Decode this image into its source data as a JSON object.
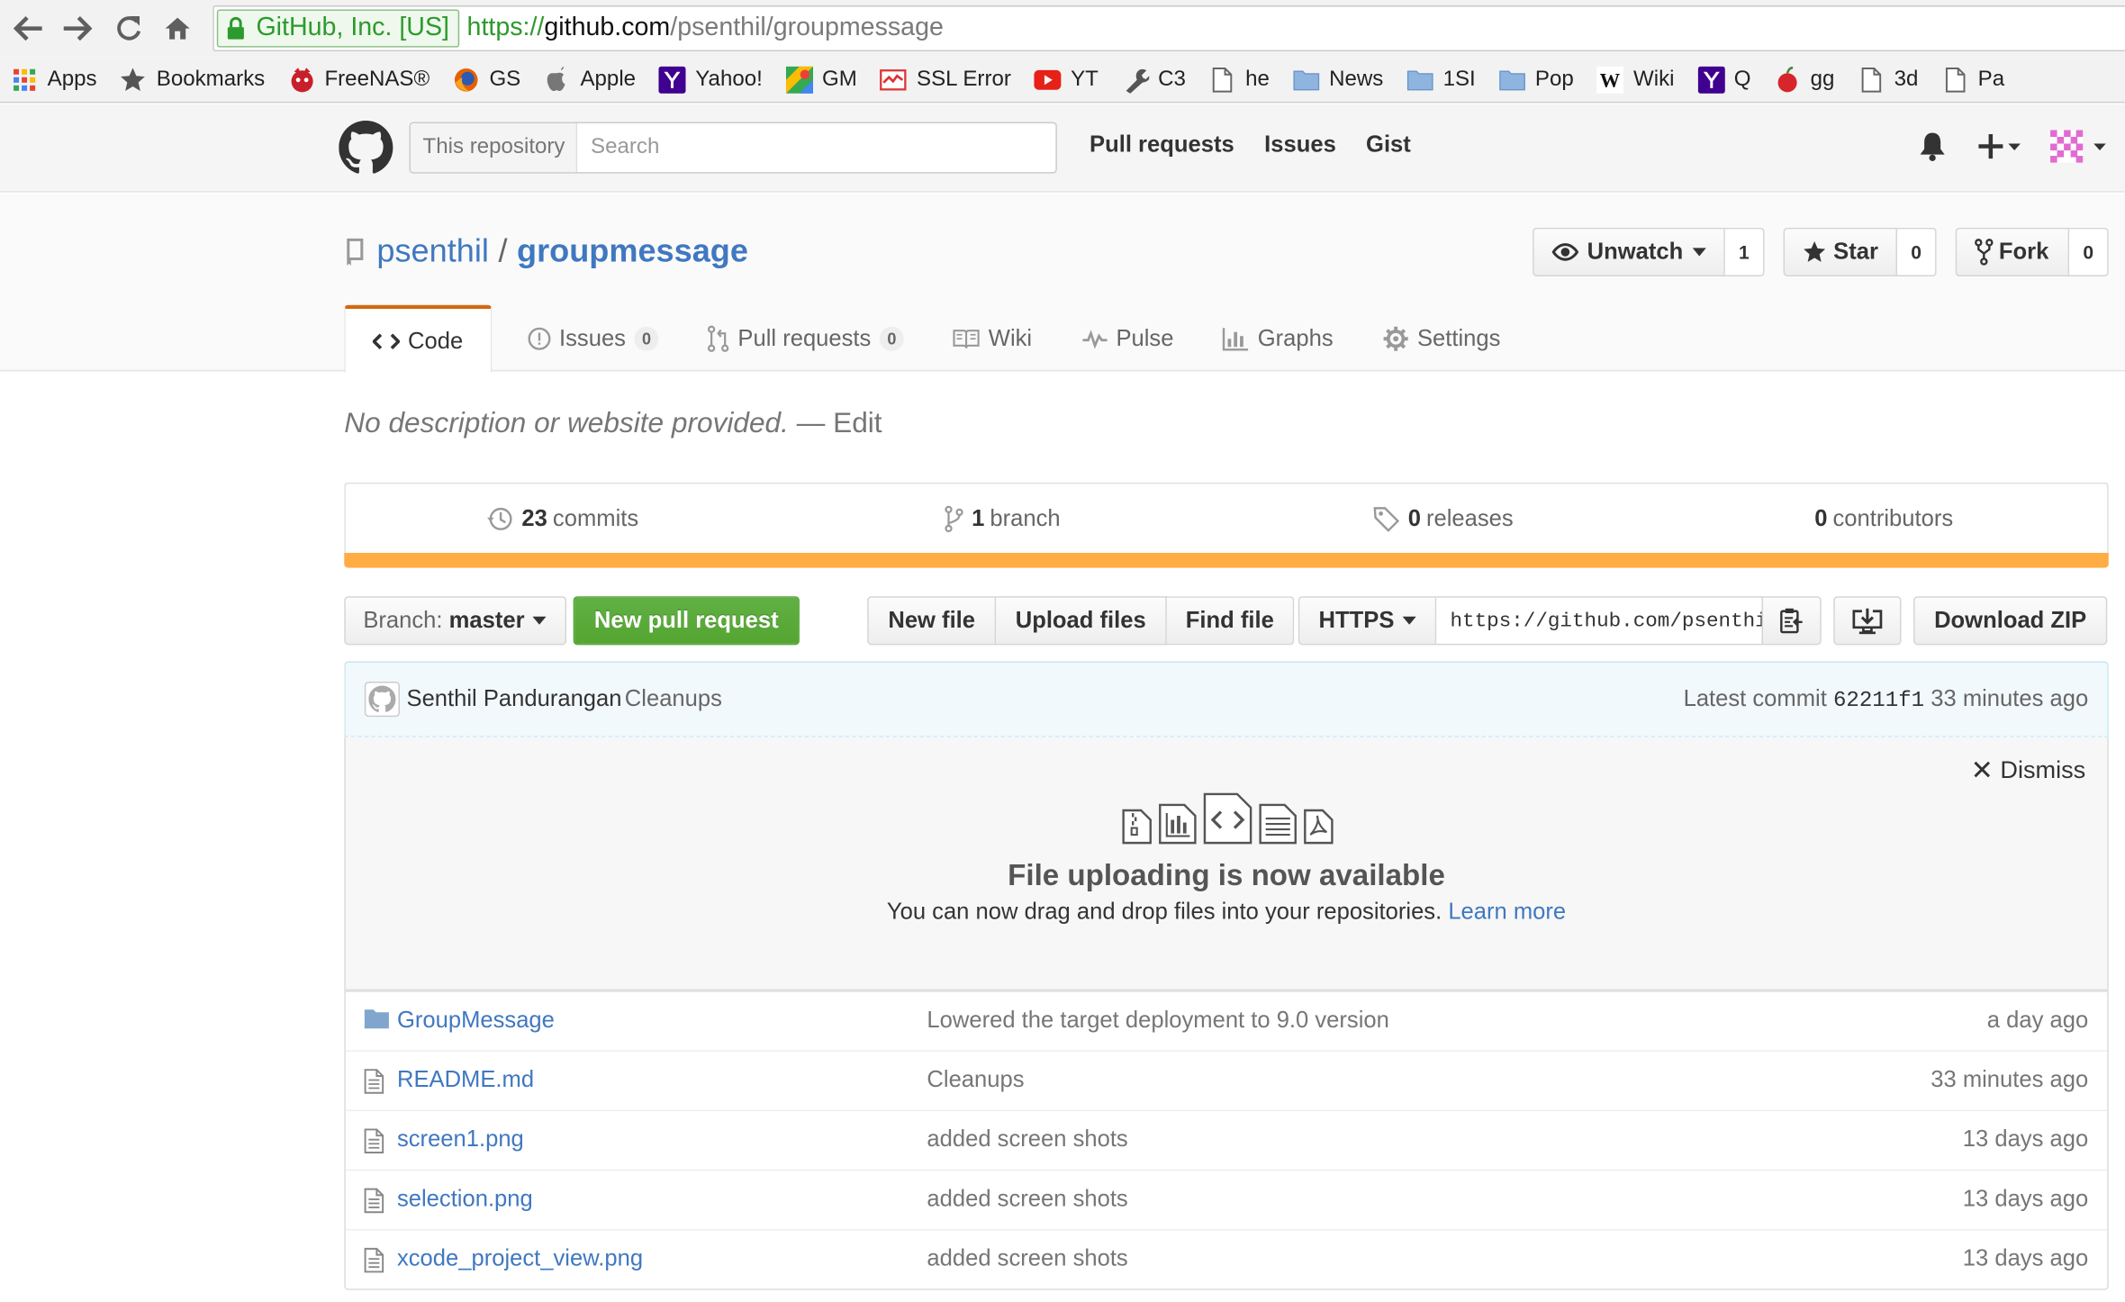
{
  "browser": {
    "ev_label": "GitHub, Inc. [US]",
    "url_scheme": "https://",
    "url_host": "github.com",
    "url_path": "/psenthil/groupmessage",
    "bookmarks": [
      {
        "label": "Apps",
        "icon": "apps-grid-icon"
      },
      {
        "label": "Bookmarks",
        "icon": "star-icon"
      },
      {
        "label": "FreeNAS®",
        "icon": "freenas-icon"
      },
      {
        "label": "GS",
        "icon": "firefox-icon"
      },
      {
        "label": "Apple",
        "icon": "apple-icon"
      },
      {
        "label": "Yahoo!",
        "icon": "yahoo-icon"
      },
      {
        "label": "GM",
        "icon": "google-maps-icon"
      },
      {
        "label": "SSL Error",
        "icon": "ssl-error-icon"
      },
      {
        "label": "YT",
        "icon": "youtube-icon"
      },
      {
        "label": "C3",
        "icon": "wrench-icon"
      },
      {
        "label": "he",
        "icon": "page-icon"
      },
      {
        "label": "News",
        "icon": "folder-icon"
      },
      {
        "label": "1SI",
        "icon": "folder-icon"
      },
      {
        "label": "Pop",
        "icon": "folder-icon"
      },
      {
        "label": "Wiki",
        "icon": "wikipedia-icon"
      },
      {
        "label": "Q",
        "icon": "yahoo-icon"
      },
      {
        "label": "gg",
        "icon": "apple-fruit-icon"
      },
      {
        "label": "3d",
        "icon": "page-icon"
      },
      {
        "label": "Pa",
        "icon": "page-icon"
      }
    ]
  },
  "header": {
    "search_scope": "This repository",
    "search_placeholder": "Search",
    "nav": [
      "Pull requests",
      "Issues",
      "Gist"
    ]
  },
  "repo": {
    "owner": "psenthil",
    "separator": "/",
    "name": "groupmessage",
    "watch": {
      "label": "Unwatch",
      "count": "1"
    },
    "star": {
      "label": "Star",
      "count": "0"
    },
    "fork": {
      "label": "Fork",
      "count": "0"
    },
    "tabs": [
      {
        "label": "Code",
        "icon": "code-icon"
      },
      {
        "label": "Issues",
        "count": "0",
        "icon": "issue-icon"
      },
      {
        "label": "Pull requests",
        "count": "0",
        "icon": "pull-request-icon"
      },
      {
        "label": "Wiki",
        "icon": "book-icon"
      },
      {
        "label": "Pulse",
        "icon": "pulse-icon"
      },
      {
        "label": "Graphs",
        "icon": "graph-icon"
      },
      {
        "label": "Settings",
        "icon": "gear-icon"
      }
    ],
    "description": "No description or website provided.",
    "dash": "—",
    "edit_label": "Edit"
  },
  "summary": {
    "commits": {
      "count": "23",
      "label": "commits"
    },
    "branches": {
      "count": "1",
      "label": "branch"
    },
    "releases": {
      "count": "0",
      "label": "releases"
    },
    "contributors": {
      "count": "0",
      "label": "contributors"
    },
    "language_color": "#ffac45"
  },
  "file_nav": {
    "branch_prefix": "Branch:",
    "branch_name": "master",
    "new_pr": "New pull request",
    "new_file": "New file",
    "upload_files": "Upload files",
    "find_file": "Find file",
    "protocol": "HTTPS",
    "clone_url": "https://github.com/psenthil/groupmessage.git",
    "download_zip": "Download ZIP"
  },
  "commit": {
    "author": "Senthil Pandurangan",
    "message": "Cleanups",
    "latest_label": "Latest commit",
    "sha": "62211f1",
    "age": "33 minutes ago"
  },
  "upload_banner": {
    "dismiss": "Dismiss",
    "title": "File uploading is now available",
    "text": "You can now drag and drop files into your repositories.",
    "link": "Learn more"
  },
  "files": [
    {
      "type": "folder",
      "name": "GroupMessage",
      "message": "Lowered the target deployment to 9.0 version",
      "age": "a day ago"
    },
    {
      "type": "file",
      "name": "README.md",
      "message": "Cleanups",
      "age": "33 minutes ago"
    },
    {
      "type": "file",
      "name": "screen1.png",
      "message": "added screen shots",
      "age": "13 days ago"
    },
    {
      "type": "file",
      "name": "selection.png",
      "message": "added screen shots",
      "age": "13 days ago"
    },
    {
      "type": "file",
      "name": "xcode_project_view.png",
      "message": "added screen shots",
      "age": "13 days ago"
    }
  ],
  "colors": {
    "link": "#4078c0",
    "green_button": "#55a532",
    "tab_accent": "#d26911"
  }
}
